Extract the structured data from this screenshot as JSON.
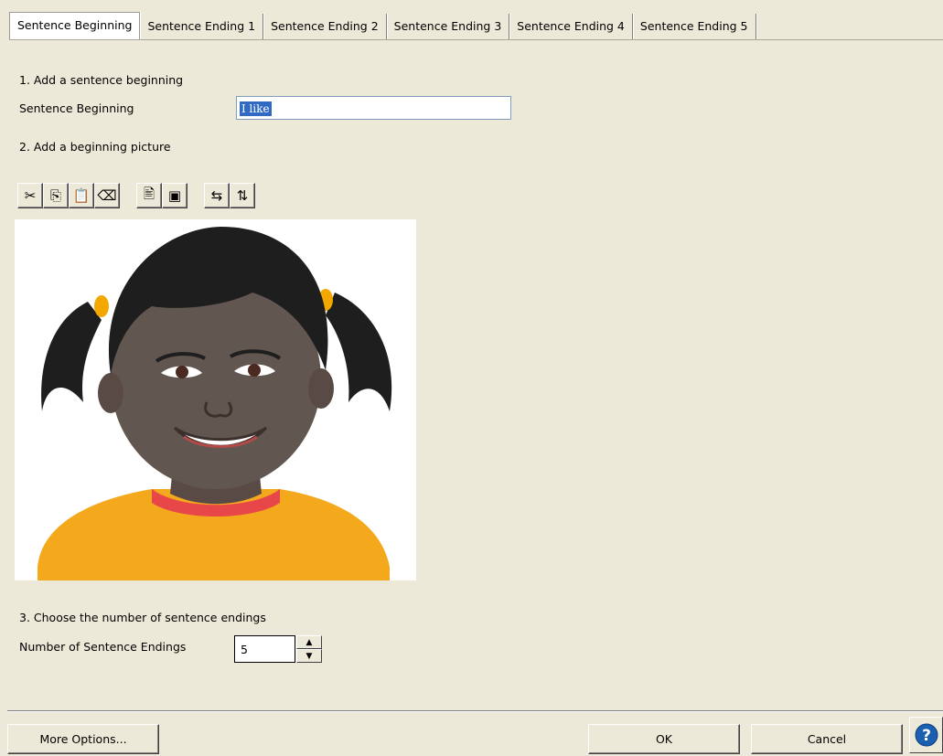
{
  "tabs": [
    {
      "label": "Sentence Beginning"
    },
    {
      "label": "Sentence Ending 1"
    },
    {
      "label": "Sentence Ending 2"
    },
    {
      "label": "Sentence Ending 3"
    },
    {
      "label": "Sentence Ending 4"
    },
    {
      "label": "Sentence Ending 5"
    }
  ],
  "step1": {
    "heading": "1. Add a sentence beginning",
    "field_label": "Sentence Beginning",
    "value": "I like"
  },
  "step2": {
    "heading": "2. Add a beginning picture"
  },
  "toolbar": {
    "buttons": [
      {
        "icon": "cut-icon",
        "glyph": "✂"
      },
      {
        "icon": "copy-icon",
        "glyph": "⎘"
      },
      {
        "icon": "paste-icon",
        "glyph": "📋"
      },
      {
        "icon": "eraser-icon",
        "glyph": "⌫"
      },
      {
        "icon": "insert-picture-icon",
        "glyph": "🖹"
      },
      {
        "icon": "picture-frame-icon",
        "glyph": "▣"
      },
      {
        "icon": "flip-horizontal-icon",
        "glyph": "⇆"
      },
      {
        "icon": "flip-vertical-icon",
        "glyph": "⇅"
      }
    ]
  },
  "step3": {
    "heading": "3. Choose the number of sentence endings",
    "field_label": "Number of Sentence Endings",
    "value": "5"
  },
  "buttons": {
    "more_options": "More Options...",
    "ok": "OK",
    "cancel": "Cancel"
  },
  "help": {
    "icon": "help-icon",
    "glyph": "?"
  },
  "colors": {
    "selection": "#316ac5",
    "face": "#ece9d8",
    "help_blue": "#1c5fb0"
  }
}
